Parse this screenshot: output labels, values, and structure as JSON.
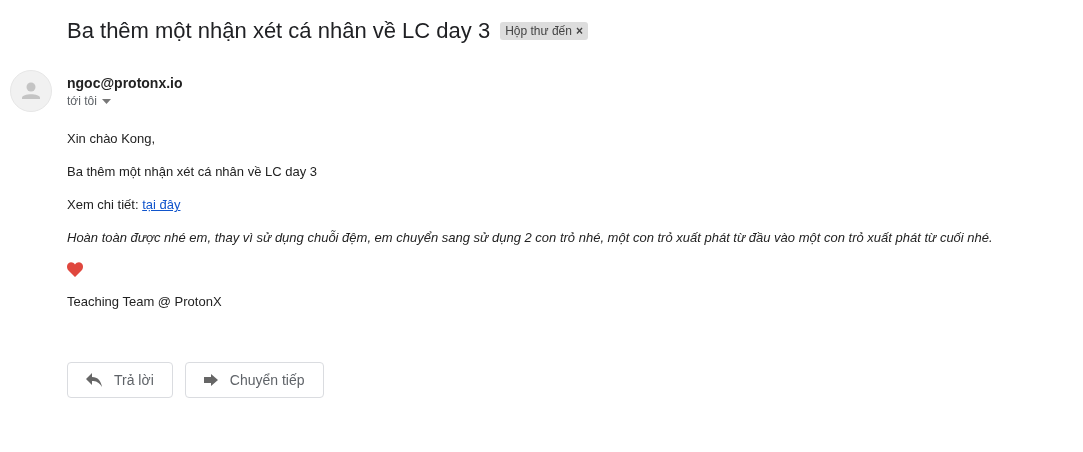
{
  "subject": "Ba thêm một nhận xét cá nhân về LC day 3",
  "label": {
    "text": "Hộp thư đến",
    "close": "×"
  },
  "sender": {
    "email": "ngoc@protonx.io",
    "recipient": "tới tôi"
  },
  "body": [
    {
      "kind": "text",
      "text": "Xin chào Kong,"
    },
    {
      "kind": "text",
      "text": "Ba thêm một nhận xét cá nhân về LC day 3"
    },
    {
      "kind": "link",
      "text": "Xem chi tiết:",
      "link": "tại đây"
    },
    {
      "kind": "italic",
      "text": "Hoàn toàn được nhé em, thay vì sử dụng chuỗi đệm, em chuyển sang sử dụng 2 con trỏ nhé, một con trỏ xuất phát từ đầu vào một con trỏ xuất phát từ cuối nhé."
    },
    {
      "kind": "heart"
    },
    {
      "kind": "text",
      "text": "Teaching Team @ ProtonX"
    }
  ],
  "actions": [
    {
      "kind": "reply",
      "label": "Trả lời"
    },
    {
      "kind": "forward",
      "label": "Chuyển tiếp"
    }
  ]
}
